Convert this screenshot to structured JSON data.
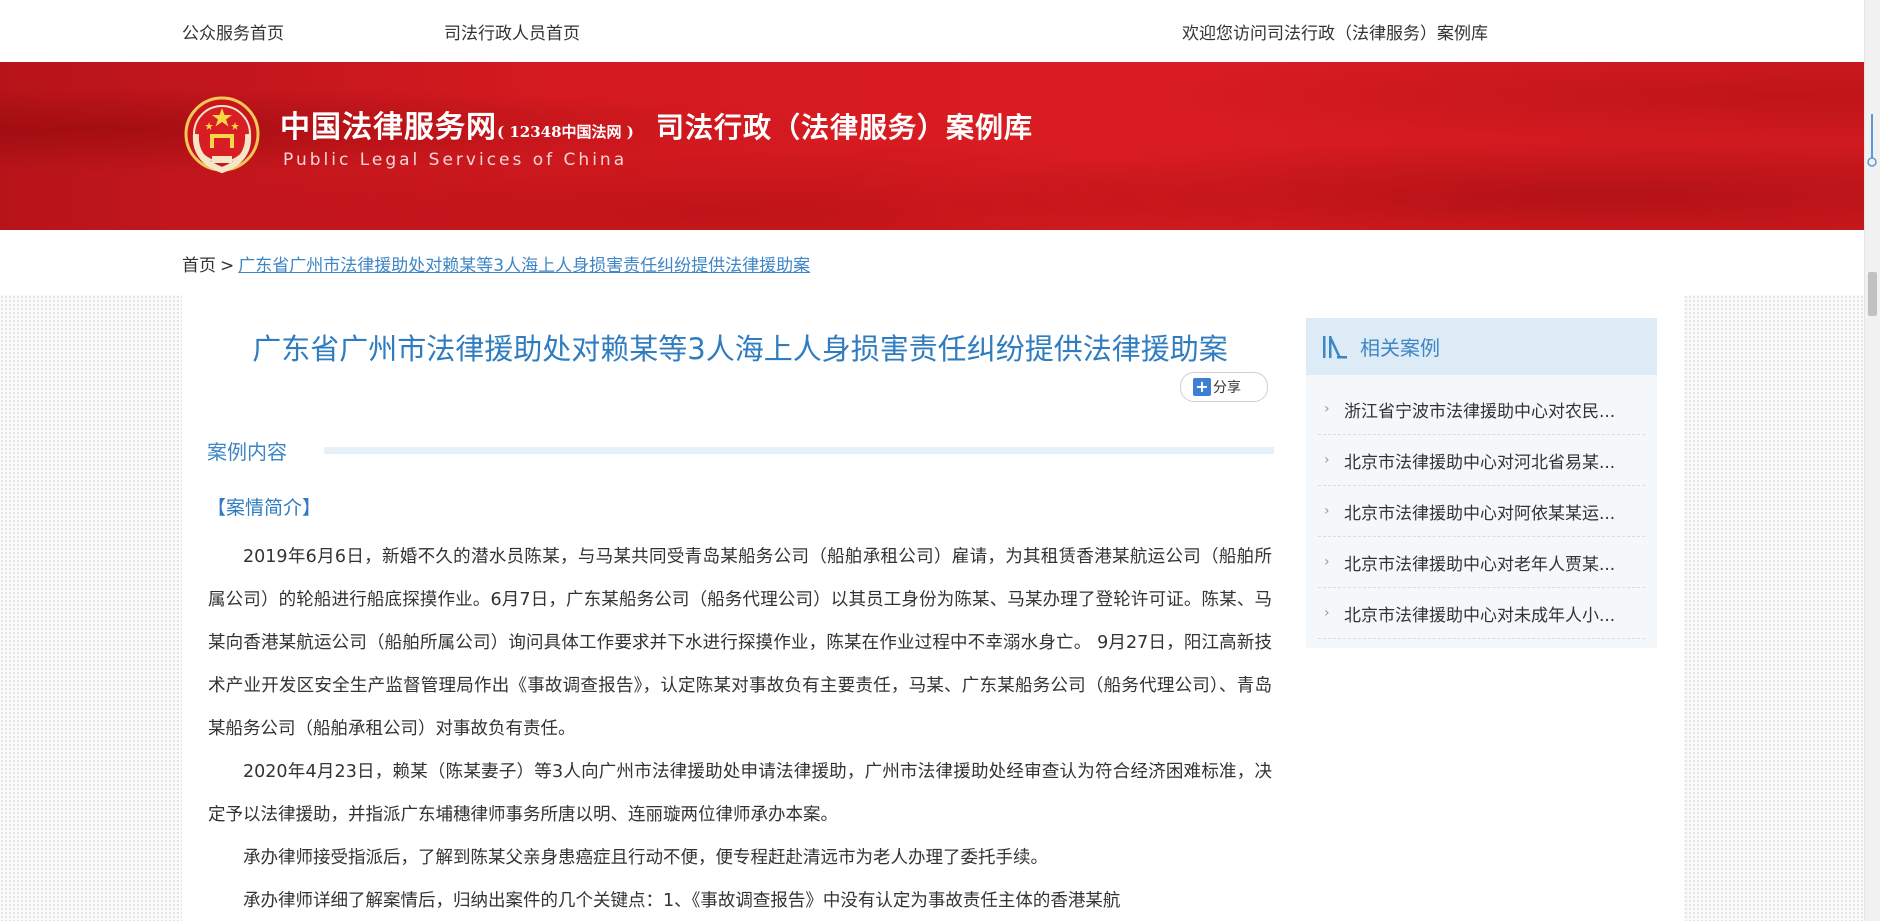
{
  "topbar": {
    "public_home": "公众服务首页",
    "judicial_home": "司法行政人员首页",
    "welcome": "欢迎您访问司法行政（法律服务）案例库"
  },
  "banner": {
    "site_name": "中国法律服务网",
    "site_hotline": "( 12348中国法网 )",
    "site_name_en": "Public Legal Services of China",
    "subtitle": "司法行政（法律服务）案例库"
  },
  "breadcrumb": {
    "home": "首页",
    "separator": ">",
    "current": "广东省广州市法律援助处对赖某等3人海上人身损害责任纠纷提供法律援助案"
  },
  "article": {
    "title": "广东省广州市法律援助处对赖某等3人海上人身损害责任纠纷提供法律援助案",
    "share_label": "分享",
    "section_heading": "案例内容",
    "intro_heading": "【案情简介】",
    "paragraphs": [
      "2019年6月6日，新婚不久的潜水员陈某，与马某共同受青岛某船务公司（船舶承租公司）雇请，为其租赁香港某航运公司（船舶所属公司）的轮船进行船底探摸作业。6月7日，广东某船务公司（船务代理公司）以其员工身份为陈某、马某办理了登轮许可证。陈某、马某向香港某航运公司（船舶所属公司）询问具体工作要求并下水进行探摸作业，陈某在作业过程中不幸溺水身亡。 9月27日，阳江高新技术产业开发区安全生产监督管理局作出《事故调查报告》，认定陈某对事故负有主要责任，马某、广东某船务公司（船务代理公司）、青岛某船务公司（船舶承租公司）对事故负有责任。",
      "2020年4月23日，赖某（陈某妻子）等3人向广州市法律援助处申请法律援助，广州市法律援助处经审查认为符合经济困难标准，决定予以法律援助，并指派广东埔穗律师事务所唐以明、连丽璇两位律师承办本案。",
      "承办律师接受指派后，了解到陈某父亲身患癌症且行动不便，便专程赶赴清远市为老人办理了委托手续。",
      "承办律师详细了解案情后，归纳出案件的几个关键点：1、《事故调查报告》中没有认定为事故责任主体的香港某航"
    ]
  },
  "sidebar": {
    "title": "相关案例",
    "items": [
      "浙江省宁波市法律援助中心对农民...",
      "北京市法律援助中心对河北省易某...",
      "北京市法律援助中心对阿依某某运...",
      "北京市法律援助中心对老年人贾某...",
      "北京市法律援助中心对未成年人小..."
    ]
  },
  "colors": {
    "banner_red": "#d41a20",
    "link_blue": "#3e86c5",
    "title_blue": "#2f7cc0",
    "sidebar_head_bg": "#ddebf7"
  },
  "icons": {
    "emblem": "national-emblem-icon",
    "share": "plus-icon",
    "sidebar_head": "bars-icon",
    "list_chevron": "chevron-right-icon"
  }
}
